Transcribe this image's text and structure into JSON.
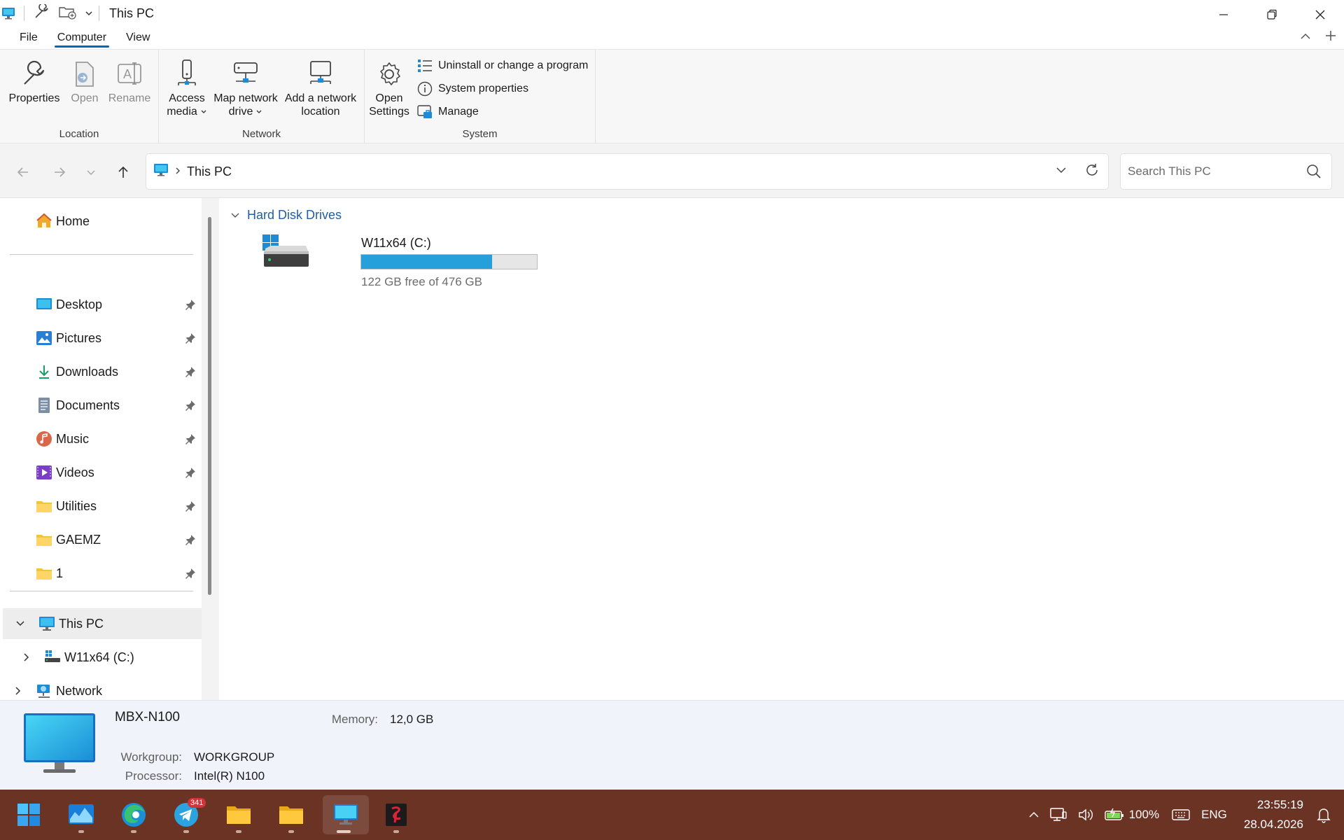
{
  "window": {
    "title": "This PC"
  },
  "ribbon": {
    "tabs": [
      "File",
      "Computer",
      "View"
    ],
    "active_tab": "Computer",
    "location": {
      "label": "Location",
      "properties": "Properties",
      "open": "Open",
      "rename": "Rename"
    },
    "network": {
      "label": "Network",
      "access_media_1": "Access",
      "access_media_2": "media",
      "map_drive_1": "Map network",
      "map_drive_2": "drive",
      "add_location_1": "Add a network",
      "add_location_2": "location"
    },
    "system": {
      "label": "System",
      "open_settings_1": "Open",
      "open_settings_2": "Settings",
      "uninstall": "Uninstall or change a program",
      "system_properties": "System properties",
      "manage": "Manage"
    }
  },
  "address": {
    "path": "This PC",
    "search_placeholder": "Search This PC"
  },
  "sidebar": {
    "home": "Home",
    "pinned": [
      {
        "label": "Desktop",
        "icon": "desktop-icon"
      },
      {
        "label": "Pictures",
        "icon": "pictures-icon"
      },
      {
        "label": "Downloads",
        "icon": "downloads-icon"
      },
      {
        "label": "Documents",
        "icon": "documents-icon"
      },
      {
        "label": "Music",
        "icon": "music-icon"
      },
      {
        "label": "Videos",
        "icon": "videos-icon"
      },
      {
        "label": "Utilities",
        "icon": "folder-icon"
      },
      {
        "label": "GAEMZ",
        "icon": "folder-icon"
      },
      {
        "label": "1",
        "icon": "folder-icon"
      }
    ],
    "this_pc": "This PC",
    "drive": "W11x64 (C:)",
    "network": "Network"
  },
  "content": {
    "group_title": "Hard Disk Drives",
    "drives": [
      {
        "name": "W11x64 (C:)",
        "free_text": "122 GB free of 476 GB",
        "used_fraction": 0.744
      }
    ]
  },
  "details": {
    "computer_name": "MBX-N100",
    "memory_label": "Memory:",
    "memory_value": "12,0 GB",
    "workgroup_label": "Workgroup:",
    "workgroup_value": "WORKGROUP",
    "processor_label": "Processor:",
    "processor_value": "Intel(R) N100"
  },
  "taskbar": {
    "telegram_badge": "341",
    "battery": "100%",
    "language": "ENG",
    "time": "23:55:19",
    "date": "28.04.2026"
  },
  "colors": {
    "accent": "#0067c0",
    "drive_fill": "#26a0da",
    "taskbar": "#6b3324"
  }
}
